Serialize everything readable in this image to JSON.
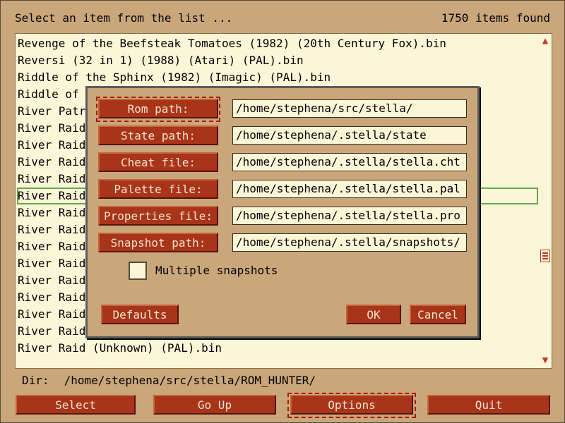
{
  "header": {
    "prompt": "Select an item from the list ...",
    "count": "1750 items found"
  },
  "list": {
    "items": [
      "Revenge of the Beefsteak Tomatoes (1982) (20th Century Fox).bin",
      "Reversi (32 in 1) (1988) (Atari) (PAL).bin",
      "Riddle of the Sphinx (1982) (Imagic) (PAL).bin",
      "Riddle of th",
      "River Patro",
      "River Raid",
      "River Raid",
      "River Raid",
      "River Raid",
      "River Raid",
      "River Raid",
      "River Raid",
      "River Raid",
      "River Raid",
      "River Raid",
      "River Raid",
      "River Raid",
      "River Raid",
      "River Raid (Unknown) (PAL).bin"
    ],
    "selected_index": 9
  },
  "scrollbar": {
    "up_arrow": "▲",
    "down_arrow": "▼",
    "position_fraction": 0.66
  },
  "dir": {
    "label": "Dir:",
    "value": "/home/stephena/src/stella/ROM_HUNTER/"
  },
  "buttons": {
    "select": "Select",
    "go_up": "Go Up",
    "options": "Options",
    "quit": "Quit"
  },
  "dialog": {
    "rows": [
      {
        "button": "Rom path:",
        "value": "/home/stephena/src/stella/"
      },
      {
        "button": "State path:",
        "value": "/home/stephena/.stella/state"
      },
      {
        "button": "Cheat file:",
        "value": "/home/stephena/.stella/stella.cht"
      },
      {
        "button": "Palette file:",
        "value": "/home/stephena/.stella/stella.pal"
      },
      {
        "button": "Properties file:",
        "value": "/home/stephena/.stella/stella.pro"
      },
      {
        "button": "Snapshot path:",
        "value": "/home/stephena/.stella/snapshots/"
      }
    ],
    "multiple_snapshots": {
      "label": "Multiple snapshots",
      "checked": false
    },
    "defaults": "Defaults",
    "ok": "OK",
    "cancel": "Cancel"
  },
  "colors": {
    "background": "#c9a77a",
    "button": "#a8341a",
    "list_bg": "#fbf6d8",
    "selection": "#69a64a"
  },
  "icons": {
    "scroll_up": "triangle-up",
    "scroll_down": "triangle-down",
    "scroll_thumb": "grip-lines"
  }
}
